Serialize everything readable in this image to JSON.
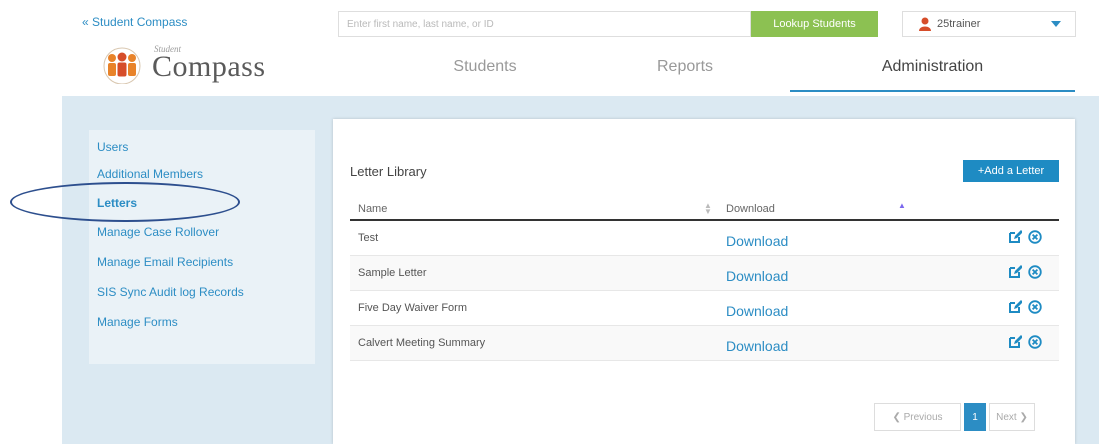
{
  "top_link": "« Student Compass",
  "logo": {
    "small": "Student",
    "text": "Compass"
  },
  "search": {
    "placeholder": "Enter first name, last name, or ID",
    "button": "Lookup Students"
  },
  "user": {
    "name": "25trainer"
  },
  "nav": {
    "students": "Students",
    "reports": "Reports",
    "administration": "Administration"
  },
  "sidebar": {
    "items": [
      {
        "label": "Users"
      },
      {
        "label": "Additional Members"
      },
      {
        "label": "Letters"
      },
      {
        "label": "Manage Case Rollover"
      },
      {
        "label": "Manage Email Recipients"
      },
      {
        "label": "SIS Sync Audit log Records"
      },
      {
        "label": "Manage Forms"
      }
    ]
  },
  "panel": {
    "title": "Letter Library",
    "add_button": "+Add a Letter",
    "columns": {
      "name": "Name",
      "download": "Download"
    },
    "rows": [
      {
        "name": "Test",
        "download": "Download"
      },
      {
        "name": "Sample Letter",
        "download": "Download"
      },
      {
        "name": "Five Day Waiver Form",
        "download": "Download"
      },
      {
        "name": "Calvert Meeting Summary",
        "download": "Download"
      }
    ]
  },
  "pagination": {
    "prev": "❮ Previous",
    "page": "1",
    "next": "Next ❯"
  },
  "colors": {
    "accent": "#2c8dc4",
    "green": "#8cc152",
    "band": "#dbe9f2",
    "annotation": "#2d4f8e"
  }
}
